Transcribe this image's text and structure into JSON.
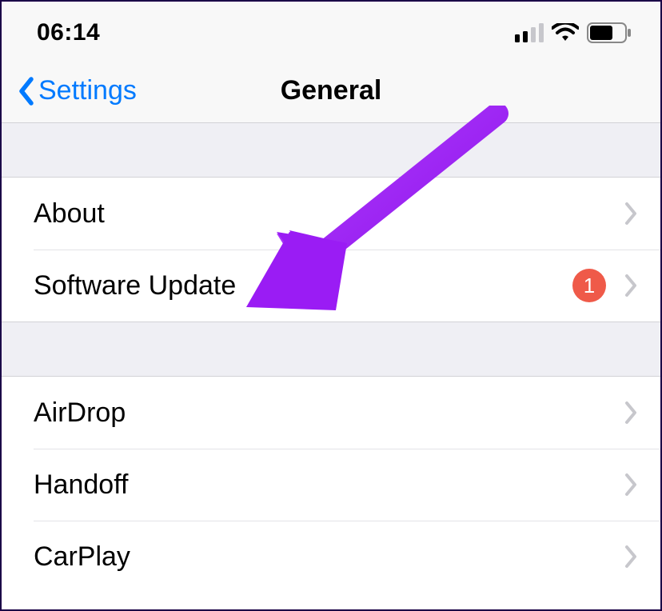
{
  "status": {
    "time": "06:14",
    "signal_bars": 2,
    "signal_total": 4,
    "wifi": true,
    "battery_level": 0.6
  },
  "nav": {
    "back_label": "Settings",
    "title": "General"
  },
  "group1": [
    {
      "label": "About",
      "badge": null
    },
    {
      "label": "Software Update",
      "badge": "1"
    }
  ],
  "group2": [
    {
      "label": "AirDrop",
      "badge": null
    },
    {
      "label": "Handoff",
      "badge": null
    },
    {
      "label": "CarPlay",
      "badge": null
    }
  ],
  "annotation": {
    "kind": "arrow",
    "color": "#a020f0",
    "target": "software-update-row"
  }
}
